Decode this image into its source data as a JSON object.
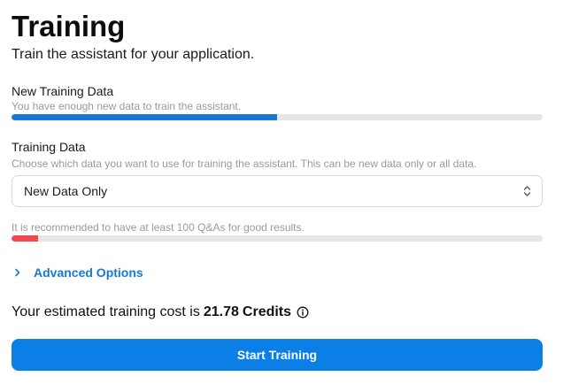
{
  "header": {
    "title": "Training",
    "subtitle": "Train the assistant for your application."
  },
  "new_training_data": {
    "label": "New Training Data",
    "hint": "You have enough new data to train the assistant.",
    "progress": 0.5,
    "color": "#1677d6"
  },
  "training_data": {
    "label": "Training Data",
    "hint": "Choose which data you want to use for training the assistant. This can be new data only or all data.",
    "selected": "New Data Only"
  },
  "recommendation": {
    "hint": "It is recommended to have at least 100 Q&As for good results.",
    "progress": 0.05,
    "color": "#f04a50"
  },
  "advanced": {
    "label": "Advanced Options",
    "icon": "chevron-right-icon",
    "color": "#1779d4"
  },
  "cost": {
    "prefix": "Your estimated training cost is",
    "amount": "21.78",
    "unit": "Credits",
    "icon": "info-icon"
  },
  "start_button": {
    "label": "Start Training",
    "color": "#0b7fe6"
  }
}
